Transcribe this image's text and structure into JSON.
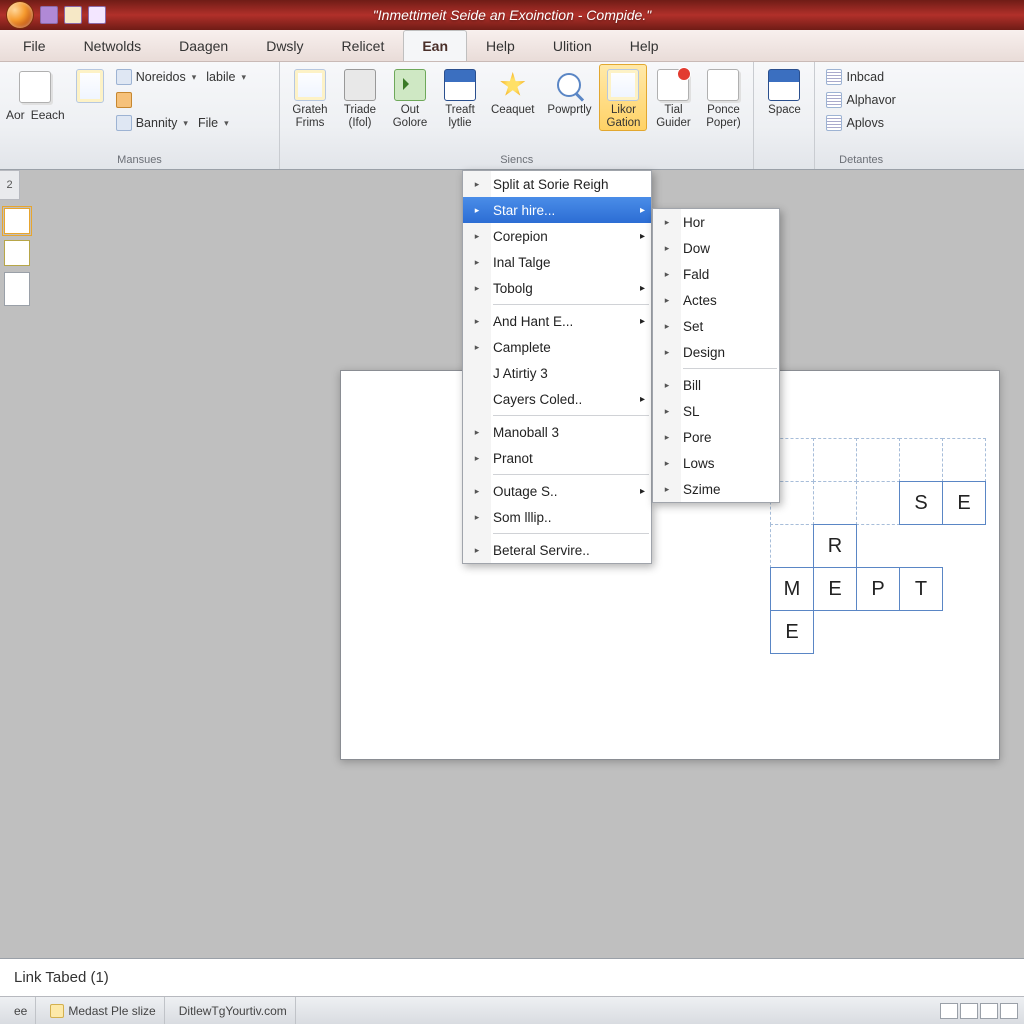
{
  "title": "\"Inmettimeit Seide an Exoinction - Compide.\"",
  "menubar": [
    "File",
    "Netwolds",
    "Daagen",
    "Dwsly",
    "Relicet",
    "Ean",
    "Help",
    "Ulition",
    "Help"
  ],
  "menubar_active_index": 5,
  "left_tab": "2",
  "notes": "Link Tabed (1)",
  "statusbar": {
    "seg1": "ee",
    "seg2": "Medast Ple slize",
    "seg3": "DitlewTgYourtiv.com"
  },
  "ribbon": {
    "group1": {
      "row1a": "Aor",
      "row1b": "Eeach",
      "btn_noreidos": "Noreidos",
      "btn_labile": "labile",
      "btn_bannity": "Bannity",
      "btn_file": "File",
      "label": "Mansues"
    },
    "group2": {
      "b1a": "Grateh",
      "b1b": "Frims",
      "b2a": "Triade",
      "b2b": "(Ifol)",
      "b3a": "Out",
      "b3b": "Golore",
      "b4a": "Treaft",
      "b4b": "lytlie",
      "b5": "Ceaquet",
      "b6": "Powprtly",
      "b7a": "Likor",
      "b7b": "Gation",
      "b8a": "Tial",
      "b8b": "Guider",
      "b9a": "Ponce",
      "b9b": "Poper)",
      "label": "Siencs"
    },
    "group3": {
      "b1": "Space"
    },
    "group4": {
      "r1": "Inbcad",
      "r2": "Alphavor",
      "r3": "Aplovs",
      "label": "Detantes"
    }
  },
  "menu1": {
    "items": [
      {
        "label": "Split at Sorie Reigh",
        "sub": false
      },
      {
        "label": "Star hire...",
        "sub": true,
        "hl": true
      },
      {
        "label": "Corepion",
        "sub": true
      },
      {
        "label": "Inal Talge",
        "sub": false
      },
      {
        "label": "Tobolg",
        "sub": true
      },
      {
        "sep": true
      },
      {
        "label": "And Hant E...",
        "sub": true
      },
      {
        "label": "Camplete",
        "sub": false
      },
      {
        "label": "J Atirtiy 3",
        "sub": false,
        "noicon": true
      },
      {
        "label": "Cayers Coled..",
        "sub": true,
        "noicon": true
      },
      {
        "sep": true
      },
      {
        "label": "Manoball 3",
        "sub": false
      },
      {
        "label": "Pranot",
        "sub": false
      },
      {
        "sep": true
      },
      {
        "label": "Outage S..",
        "sub": true
      },
      {
        "label": "Som lllip..",
        "sub": false
      },
      {
        "sep": true
      },
      {
        "label": "Beteral Servire..",
        "sub": false
      }
    ]
  },
  "menu2": {
    "items": [
      {
        "label": "Hor"
      },
      {
        "label": "Dow"
      },
      {
        "label": "Fald"
      },
      {
        "label": "Actes"
      },
      {
        "label": "Set"
      },
      {
        "label": "Design"
      },
      {
        "sep": true
      },
      {
        "label": "Bill"
      },
      {
        "label": "SL"
      },
      {
        "label": "Pore"
      },
      {
        "label": "Lows"
      },
      {
        "label": "Szime"
      }
    ]
  },
  "cells": {
    "r1": [
      "",
      "",
      "",
      "",
      ""
    ],
    "r2": [
      "",
      "",
      "",
      "S",
      "E"
    ],
    "r3": [
      "",
      "R",
      "",
      "",
      ""
    ],
    "r4": [
      "M",
      "E",
      "P",
      "T",
      ""
    ],
    "r5": [
      "E",
      "",
      "",
      "",
      ""
    ]
  }
}
